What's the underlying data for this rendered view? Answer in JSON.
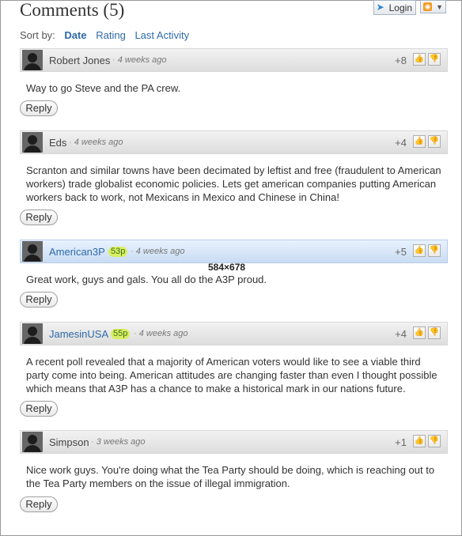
{
  "header": {
    "title": "Comments (5)",
    "login_label": "Login",
    "login_icon": "login-icon",
    "rss_icon": "rss-icon",
    "dropdown_icon": "chevron-down-icon"
  },
  "sort": {
    "label": "Sort by:",
    "options": [
      "Date",
      "Rating",
      "Last Activity"
    ]
  },
  "overlay_text": "584×678",
  "comments": [
    {
      "author": "Robert Jones",
      "badge": "",
      "ago": "4 weeks ago",
      "score": "+8",
      "text": "Way to go Steve and the PA crew.",
      "reply": "Reply",
      "highlight": false,
      "author_link": false
    },
    {
      "author": "Eds",
      "badge": "",
      "ago": "4 weeks ago",
      "score": "+4",
      "text": "Scranton and similar towns have been decimated by leftist and free (fraudulent to American workers) trade globalist economic policies. Lets get american companies putting American workers back to work, not Mexicans in Mexico and Chinese in China!",
      "reply": "Reply",
      "highlight": false,
      "author_link": false
    },
    {
      "author": "American3P",
      "badge": "53p",
      "ago": "4 weeks ago",
      "score": "+5",
      "text": "Great work, guys and gals. You all do the A3P proud.",
      "reply": "Reply",
      "highlight": true,
      "author_link": true
    },
    {
      "author": "JamesinUSA",
      "badge": "55p",
      "ago": "4 weeks ago",
      "score": "+4",
      "text": "A recent poll revealed that a majority of American voters would like to see a viable third party come into being. American attitudes are changing faster than even I thought possible which means that A3P has a chance to make a historical mark in our nations future.",
      "reply": "Reply",
      "highlight": false,
      "author_link": true
    },
    {
      "author": "Simpson",
      "badge": "",
      "ago": "3 weeks ago",
      "score": "+1",
      "text": "Nice work guys. You're doing what the Tea Party should be doing, which is reaching out to the Tea Party members on the issue of illegal immigration.",
      "reply": "Reply",
      "highlight": false,
      "author_link": false
    }
  ]
}
